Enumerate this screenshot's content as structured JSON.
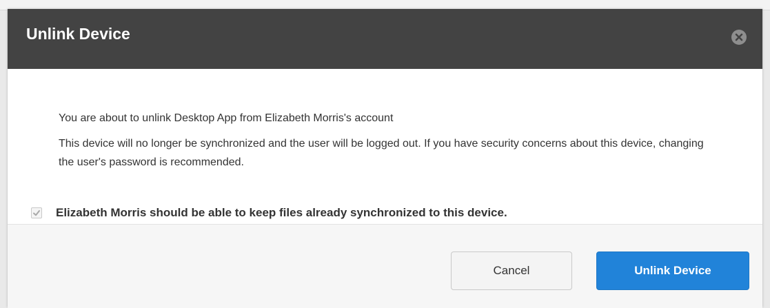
{
  "dialog": {
    "title": "Unlink Device",
    "message_line1": "You are about to unlink Desktop App from Elizabeth Morris's account",
    "message_line2": "This device will no longer be synchronized and the user will be logged out. If you have security concerns about this device, changing the user's password is recommended.",
    "keep_files_checkbox": {
      "label": "Elizabeth Morris should be able to keep files already synchronized to this device.",
      "checked": true
    },
    "buttons": {
      "cancel_label": "Cancel",
      "confirm_label": "Unlink Device"
    },
    "icons": {
      "close": "close-icon",
      "check": "check-icon"
    }
  },
  "colors": {
    "header_bg": "#434343",
    "primary_button": "#2183d9",
    "footer_bg": "#f6f6f6"
  }
}
